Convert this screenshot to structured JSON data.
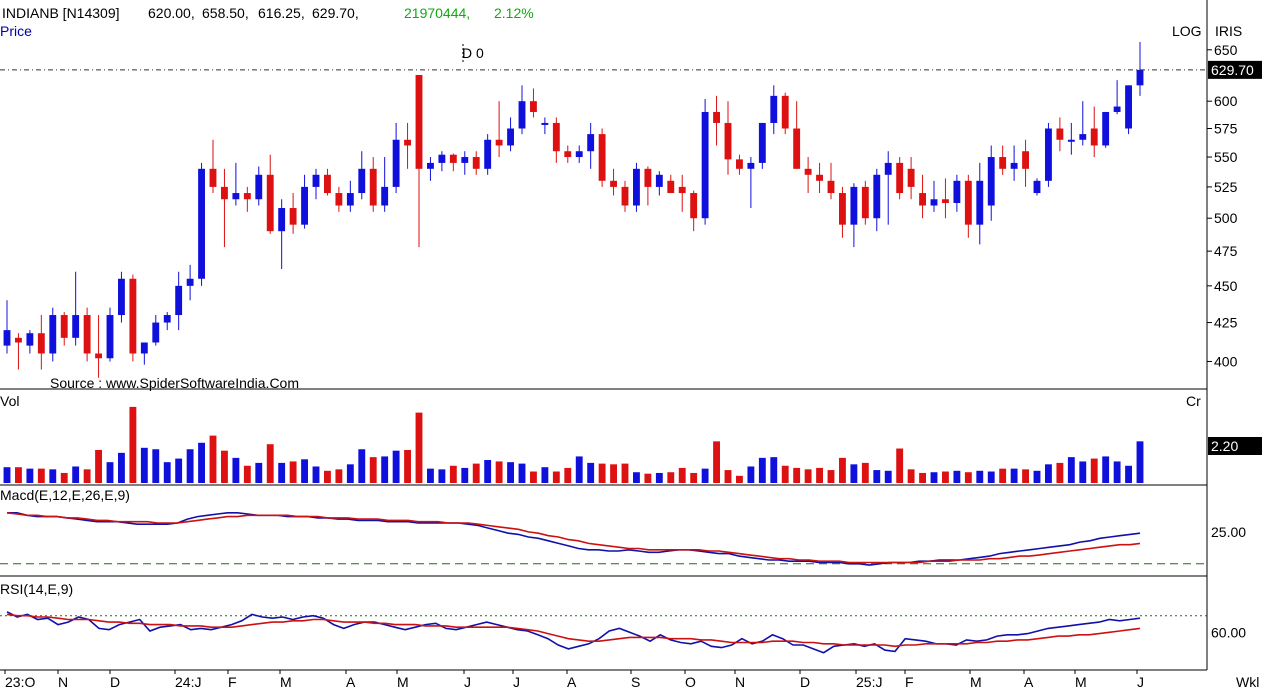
{
  "header": {
    "symbol": "INDIANB [N14309]",
    "open": "620.00,",
    "high": "658.50,",
    "low": "616.25,",
    "close": "629.70,",
    "volume": "21970444,",
    "change": "2.12%",
    "price_label": "Price",
    "log_label": "LOG",
    "iris_label": "IRIS",
    "marker_label": "D 0",
    "source": "Source : www.SpiderSoftwareIndia.Com",
    "period": "Wkl"
  },
  "colors": {
    "up": "#1010dd",
    "down": "#dd1111",
    "ma": "#cc1111",
    "text": "#000000",
    "accent": "#11aa11",
    "label_blue": "#0000aa"
  },
  "chart_data": [
    {
      "type": "candlestick",
      "scale": "log",
      "ylim": [
        385,
        660
      ],
      "yticks": [
        400,
        425,
        450,
        475,
        500,
        525,
        550,
        575,
        600,
        650
      ],
      "last_price": "629.70",
      "candles": [
        [
          410,
          440,
          405,
          420
        ],
        [
          415,
          418,
          395,
          412
        ],
        [
          410,
          420,
          405,
          418
        ],
        [
          418,
          430,
          395,
          405
        ],
        [
          405,
          435,
          400,
          430
        ],
        [
          430,
          432,
          410,
          415
        ],
        [
          415,
          460,
          410,
          430
        ],
        [
          430,
          435,
          400,
          405
        ],
        [
          405,
          430,
          390,
          402
        ],
        [
          402,
          435,
          400,
          430
        ],
        [
          430,
          460,
          425,
          455
        ],
        [
          455,
          458,
          400,
          405
        ],
        [
          405,
          412,
          398,
          412
        ],
        [
          412,
          430,
          410,
          425
        ],
        [
          425,
          432,
          420,
          430
        ],
        [
          430,
          460,
          420,
          450
        ],
        [
          450,
          465,
          440,
          455
        ],
        [
          455,
          545,
          450,
          540
        ],
        [
          540,
          565,
          520,
          525
        ],
        [
          525,
          540,
          478,
          515
        ],
        [
          515,
          545,
          510,
          520
        ],
        [
          520,
          525,
          505,
          515
        ],
        [
          515,
          542,
          510,
          535
        ],
        [
          535,
          552,
          488,
          490
        ],
        [
          490,
          515,
          462,
          508
        ],
        [
          508,
          520,
          488,
          495
        ],
        [
          495,
          535,
          492,
          525
        ],
        [
          525,
          540,
          515,
          535
        ],
        [
          535,
          540,
          518,
          520
        ],
        [
          520,
          525,
          505,
          510
        ],
        [
          510,
          530,
          505,
          520
        ],
        [
          520,
          555,
          515,
          540
        ],
        [
          540,
          550,
          505,
          510
        ],
        [
          510,
          550,
          505,
          525
        ],
        [
          525,
          580,
          520,
          565
        ],
        [
          565,
          580,
          540,
          560
        ],
        [
          625,
          625,
          478,
          540
        ],
        [
          540,
          550,
          530,
          545
        ],
        [
          545,
          555,
          538,
          552
        ],
        [
          552,
          553,
          538,
          545
        ],
        [
          545,
          555,
          535,
          550
        ],
        [
          550,
          555,
          535,
          540
        ],
        [
          540,
          570,
          535,
          565
        ],
        [
          565,
          600,
          550,
          560
        ],
        [
          560,
          585,
          555,
          575
        ],
        [
          575,
          615,
          570,
          600
        ],
        [
          600,
          612,
          585,
          590
        ],
        [
          580,
          585,
          570,
          580
        ],
        [
          580,
          585,
          545,
          555
        ],
        [
          555,
          560,
          545,
          550
        ],
        [
          550,
          560,
          545,
          555
        ],
        [
          555,
          580,
          540,
          570
        ],
        [
          570,
          575,
          525,
          530
        ],
        [
          530,
          540,
          518,
          525
        ],
        [
          525,
          530,
          505,
          510
        ],
        [
          510,
          545,
          505,
          540
        ],
        [
          540,
          542,
          510,
          525
        ],
        [
          525,
          538,
          518,
          535
        ],
        [
          530,
          535,
          520,
          520
        ],
        [
          525,
          535,
          505,
          520
        ],
        [
          520,
          522,
          490,
          500
        ],
        [
          500,
          602,
          495,
          590
        ],
        [
          590,
          605,
          560,
          580
        ],
        [
          580,
          600,
          535,
          548
        ],
        [
          548,
          552,
          535,
          540
        ],
        [
          540,
          550,
          508,
          545
        ],
        [
          545,
          580,
          540,
          580
        ],
        [
          580,
          615,
          570,
          605
        ],
        [
          605,
          608,
          570,
          575
        ],
        [
          575,
          600,
          540,
          540
        ],
        [
          540,
          550,
          520,
          535
        ],
        [
          535,
          545,
          520,
          530
        ],
        [
          530,
          545,
          515,
          520
        ],
        [
          520,
          525,
          485,
          495
        ],
        [
          495,
          528,
          478,
          525
        ],
        [
          525,
          530,
          495,
          500
        ],
        [
          500,
          540,
          490,
          535
        ],
        [
          535,
          555,
          495,
          545
        ],
        [
          545,
          550,
          515,
          520
        ],
        [
          540,
          550,
          515,
          525
        ],
        [
          520,
          535,
          500,
          510
        ],
        [
          510,
          530,
          505,
          515
        ],
        [
          515,
          532,
          500,
          512
        ],
        [
          512,
          535,
          505,
          530
        ],
        [
          530,
          535,
          485,
          495
        ],
        [
          495,
          545,
          480,
          530
        ],
        [
          510,
          560,
          498,
          550
        ],
        [
          550,
          560,
          535,
          540
        ],
        [
          540,
          560,
          530,
          545
        ],
        [
          555,
          565,
          525,
          540
        ],
        [
          520,
          532,
          518,
          530
        ],
        [
          530,
          580,
          525,
          575
        ],
        [
          575,
          585,
          555,
          565
        ],
        [
          565,
          580,
          552,
          565
        ],
        [
          565,
          600,
          560,
          570
        ],
        [
          575,
          595,
          550,
          560
        ],
        [
          560,
          590,
          558,
          590
        ],
        [
          590,
          620,
          588,
          595
        ],
        [
          575,
          615,
          570,
          615
        ],
        [
          615,
          658,
          605,
          630
        ]
      ]
    },
    {
      "type": "bar",
      "title": "Vol",
      "unit": "Cr",
      "last_value": "2.20",
      "ylim": [
        0,
        1.1
      ],
      "values": [
        0.22,
        0.22,
        0.2,
        0.2,
        0.19,
        0.14,
        0.23,
        0.19,
        0.46,
        0.29,
        0.42,
        1.06,
        0.49,
        0.47,
        0.29,
        0.34,
        0.47,
        0.56,
        0.66,
        0.45,
        0.35,
        0.24,
        0.28,
        0.54,
        0.28,
        0.3,
        0.33,
        0.23,
        0.17,
        0.19,
        0.26,
        0.47,
        0.36,
        0.37,
        0.45,
        0.46,
        0.98,
        0.2,
        0.19,
        0.24,
        0.21,
        0.27,
        0.32,
        0.3,
        0.29,
        0.27,
        0.16,
        0.22,
        0.16,
        0.21,
        0.37,
        0.28,
        0.27,
        0.26,
        0.27,
        0.15,
        0.13,
        0.14,
        0.15,
        0.21,
        0.14,
        0.2,
        0.58,
        0.18,
        0.1,
        0.23,
        0.35,
        0.36,
        0.24,
        0.21,
        0.19,
        0.21,
        0.18,
        0.35,
        0.26,
        0.28,
        0.18,
        0.17,
        0.48,
        0.19,
        0.14,
        0.15,
        0.16,
        0.17,
        0.15,
        0.17,
        0.16,
        0.2,
        0.2,
        0.19,
        0.17,
        0.26,
        0.28,
        0.36,
        0.3,
        0.34,
        0.37,
        0.3,
        0.24,
        0.58
      ]
    },
    {
      "type": "line",
      "title": "Macd(E,12,E,26,E,9)",
      "ylim": [
        -8,
        50
      ],
      "ytick": "25.00",
      "signal_level": 0,
      "series": [
        {
          "values": [
            40,
            40,
            38,
            37,
            37,
            37,
            36,
            35,
            34,
            33,
            33,
            33,
            32,
            31,
            31,
            31,
            31,
            32,
            35,
            37,
            38,
            39,
            40,
            40,
            39,
            38,
            38,
            38,
            37,
            37,
            37,
            36,
            36,
            35,
            35,
            34,
            34,
            34,
            33,
            33,
            33,
            32,
            32,
            32,
            32,
            32,
            31,
            30,
            28,
            26,
            24,
            23,
            21,
            20,
            18,
            16,
            14,
            12,
            11,
            11,
            10,
            10,
            11,
            10,
            9,
            9,
            10,
            11,
            11,
            10,
            9,
            8,
            8,
            6,
            5,
            4,
            3,
            3,
            2,
            2,
            2,
            1,
            1,
            1,
            0,
            0,
            -1,
            0,
            1,
            1,
            1,
            2,
            2,
            3,
            3,
            3,
            4,
            5,
            6,
            8,
            9,
            10,
            11,
            12,
            13,
            14,
            15,
            17,
            18,
            20,
            21,
            22,
            23,
            24
          ]
        },
        {
          "values": [
            40,
            39,
            38,
            38,
            37,
            37,
            36,
            36,
            35,
            34,
            34,
            33,
            33,
            33,
            33,
            32,
            32,
            32,
            33,
            34,
            35,
            36,
            37,
            37,
            38,
            38,
            38,
            38,
            38,
            37,
            37,
            37,
            36,
            36,
            36,
            35,
            35,
            35,
            34,
            34,
            34,
            33,
            33,
            33,
            32,
            32,
            32,
            31,
            30,
            29,
            28,
            27,
            25,
            24,
            22,
            21,
            19,
            18,
            16,
            15,
            14,
            13,
            12,
            12,
            11,
            11,
            11,
            11,
            11,
            11,
            10,
            10,
            9,
            8,
            7,
            6,
            5,
            4,
            4,
            3,
            3,
            2,
            2,
            2,
            1,
            1,
            1,
            1,
            1,
            1,
            1,
            1,
            2,
            2,
            2,
            3,
            3,
            3,
            4,
            4,
            5,
            6,
            6,
            7,
            8,
            9,
            10,
            11,
            12,
            13,
            14,
            15,
            15,
            16
          ]
        }
      ]
    },
    {
      "type": "line",
      "title": "RSI(14,E,9)",
      "ylim": [
        32,
        90
      ],
      "ytick": "60.00",
      "reference_level": 73,
      "series": [
        {
          "values": [
            76,
            72,
            74,
            70,
            71,
            66,
            68,
            72,
            70,
            63,
            62,
            66,
            68,
            70,
            61,
            64,
            65,
            66,
            62,
            63,
            62,
            64,
            66,
            69,
            74,
            72,
            71,
            72,
            70,
            72,
            73,
            71,
            66,
            63,
            66,
            68,
            68,
            66,
            64,
            62,
            64,
            66,
            67,
            63,
            62,
            64,
            66,
            68,
            66,
            64,
            62,
            61,
            58,
            55,
            50,
            47,
            49,
            51,
            55,
            61,
            63,
            60,
            57,
            53,
            58,
            54,
            52,
            51,
            53,
            49,
            48,
            50,
            55,
            51,
            53,
            58,
            55,
            50,
            50,
            47,
            44,
            49,
            50,
            51,
            49,
            51,
            46,
            45,
            55,
            54,
            53,
            51,
            51,
            50,
            54,
            53,
            54,
            57,
            58,
            58,
            59,
            61,
            63,
            64,
            65,
            66,
            67,
            68,
            70,
            69,
            70,
            71
          ]
        },
        {
          "values": [
            74,
            73,
            73,
            72,
            72,
            71,
            70,
            70,
            70,
            69,
            68,
            68,
            67,
            67,
            66,
            66,
            66,
            65,
            65,
            65,
            64,
            64,
            64,
            65,
            66,
            67,
            68,
            68,
            69,
            69,
            70,
            70,
            69,
            68,
            68,
            68,
            67,
            67,
            66,
            66,
            66,
            65,
            65,
            65,
            64,
            64,
            64,
            64,
            64,
            64,
            63,
            62,
            61,
            59,
            57,
            55,
            54,
            53,
            53,
            54,
            55,
            56,
            56,
            56,
            56,
            55,
            55,
            55,
            54,
            54,
            53,
            52,
            52,
            52,
            52,
            53,
            53,
            53,
            52,
            52,
            51,
            51,
            50,
            50,
            50,
            50,
            50,
            49,
            50,
            50,
            51,
            51,
            51,
            51,
            51,
            52,
            52,
            53,
            53,
            54,
            54,
            55,
            56,
            57,
            57,
            58,
            58,
            59,
            60,
            61,
            62,
            63
          ]
        }
      ]
    }
  ],
  "xaxis": {
    "labels": [
      "23:O",
      "N",
      "D",
      "24:J",
      "F",
      "M",
      "A",
      "M",
      "J",
      "J",
      "A",
      "S",
      "O",
      "N",
      "D",
      "25:J",
      "F",
      "M",
      "A",
      "M",
      "J"
    ]
  }
}
